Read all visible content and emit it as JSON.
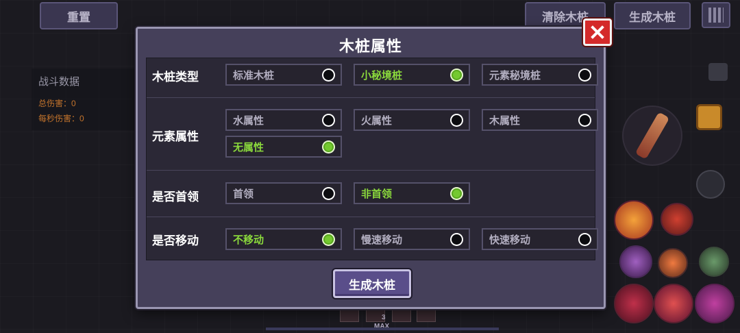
{
  "hud": {
    "reset_label": "重置",
    "clear_label": "清除木桩",
    "spawn_label": "生成木桩"
  },
  "stats": {
    "title": "战斗数据",
    "total_damage": "总伤害：0",
    "dps": "每秒伤害：0"
  },
  "hotbar": {
    "count": "3",
    "max_label": "MAX"
  },
  "modal": {
    "title": "木桩属性",
    "spawn_button": "生成木桩",
    "sections": {
      "type": {
        "label": "木桩类型",
        "options": [
          {
            "label": "标准木桩",
            "selected": false
          },
          {
            "label": "小秘境桩",
            "selected": true
          },
          {
            "label": "元素秘境桩",
            "selected": false
          }
        ]
      },
      "element": {
        "label": "元素属性",
        "options": [
          {
            "label": "水属性",
            "selected": false
          },
          {
            "label": "火属性",
            "selected": false
          },
          {
            "label": "木属性",
            "selected": false
          },
          {
            "label": "无属性",
            "selected": true
          }
        ]
      },
      "boss": {
        "label": "是否首领",
        "options": [
          {
            "label": "首领",
            "selected": false
          },
          {
            "label": "非首领",
            "selected": true
          }
        ]
      },
      "move": {
        "label": "是否移动",
        "options": [
          {
            "label": "不移动",
            "selected": true
          },
          {
            "label": "慢速移动",
            "selected": false
          },
          {
            "label": "快速移动",
            "selected": false
          }
        ]
      }
    }
  },
  "colors": {
    "selected_text": "#8ad83c",
    "radio_on": "#74c930",
    "close_red": "#d42a2a"
  }
}
